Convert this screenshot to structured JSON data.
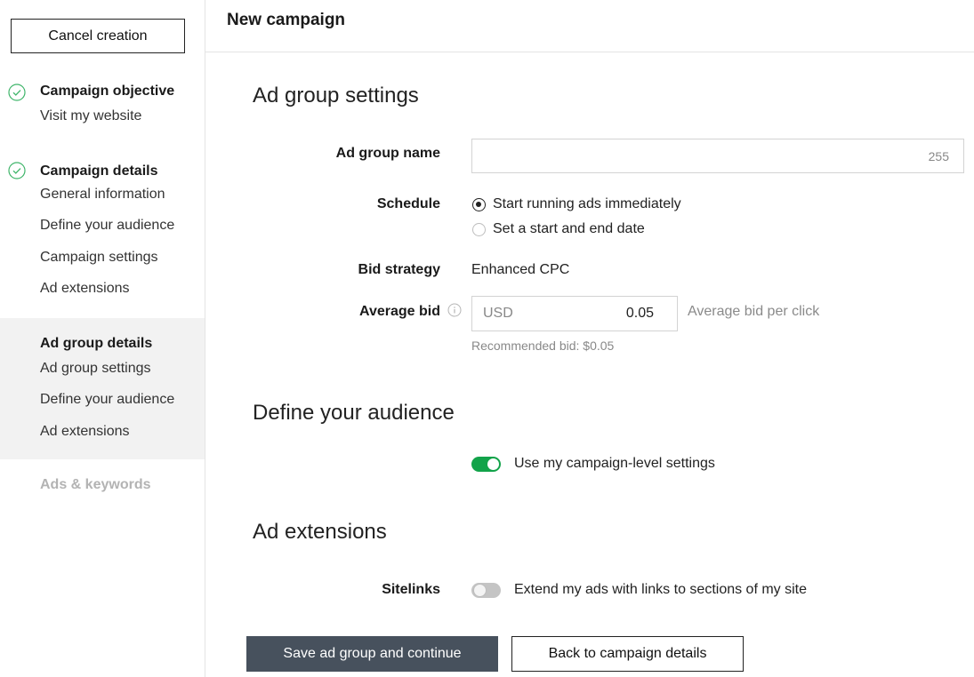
{
  "sidebar": {
    "cancel_label": "Cancel creation",
    "steps": [
      {
        "title": "Campaign objective",
        "items": [
          "Visit my website"
        ],
        "status": "complete"
      },
      {
        "title": "Campaign details",
        "items": [
          "General information",
          "Define your audience",
          "Campaign settings",
          "Ad extensions"
        ],
        "status": "complete"
      },
      {
        "title": "Ad group details",
        "items": [
          "Ad group settings",
          "Define your audience",
          "Ad extensions"
        ],
        "status": "active"
      },
      {
        "title": "Ads & keywords",
        "status": "disabled"
      }
    ]
  },
  "header": {
    "title": "New campaign"
  },
  "main": {
    "ad_group_settings": {
      "title": "Ad group settings",
      "name_label": "Ad group name",
      "name_value": "",
      "name_char_count": "255",
      "schedule_label": "Schedule",
      "schedule_options": [
        {
          "label": "Start running ads immediately",
          "selected": true
        },
        {
          "label": "Set a start and end date",
          "selected": false
        }
      ],
      "bid_strategy_label": "Bid strategy",
      "bid_strategy_value": "Enhanced CPC",
      "avg_bid_label": "Average bid",
      "avg_bid_currency": "USD",
      "avg_bid_value": "0.05",
      "avg_bid_hint": "Average bid per click",
      "recommended_bid": "Recommended bid: $0.05"
    },
    "audience": {
      "title": "Define your audience",
      "toggle_label": "Use my campaign-level settings",
      "toggle_on": true
    },
    "ad_extensions": {
      "title": "Ad extensions",
      "sitelinks_label": "Sitelinks",
      "sitelinks_toggle_label": "Extend my ads with links to sections of my site",
      "sitelinks_on": false
    },
    "actions": {
      "save_label": "Save ad group and continue",
      "back_label": "Back to campaign details"
    }
  },
  "colors": {
    "accent_green": "#12a34a",
    "primary_button": "#47515d",
    "active_step_bg": "#f2f2f2"
  }
}
